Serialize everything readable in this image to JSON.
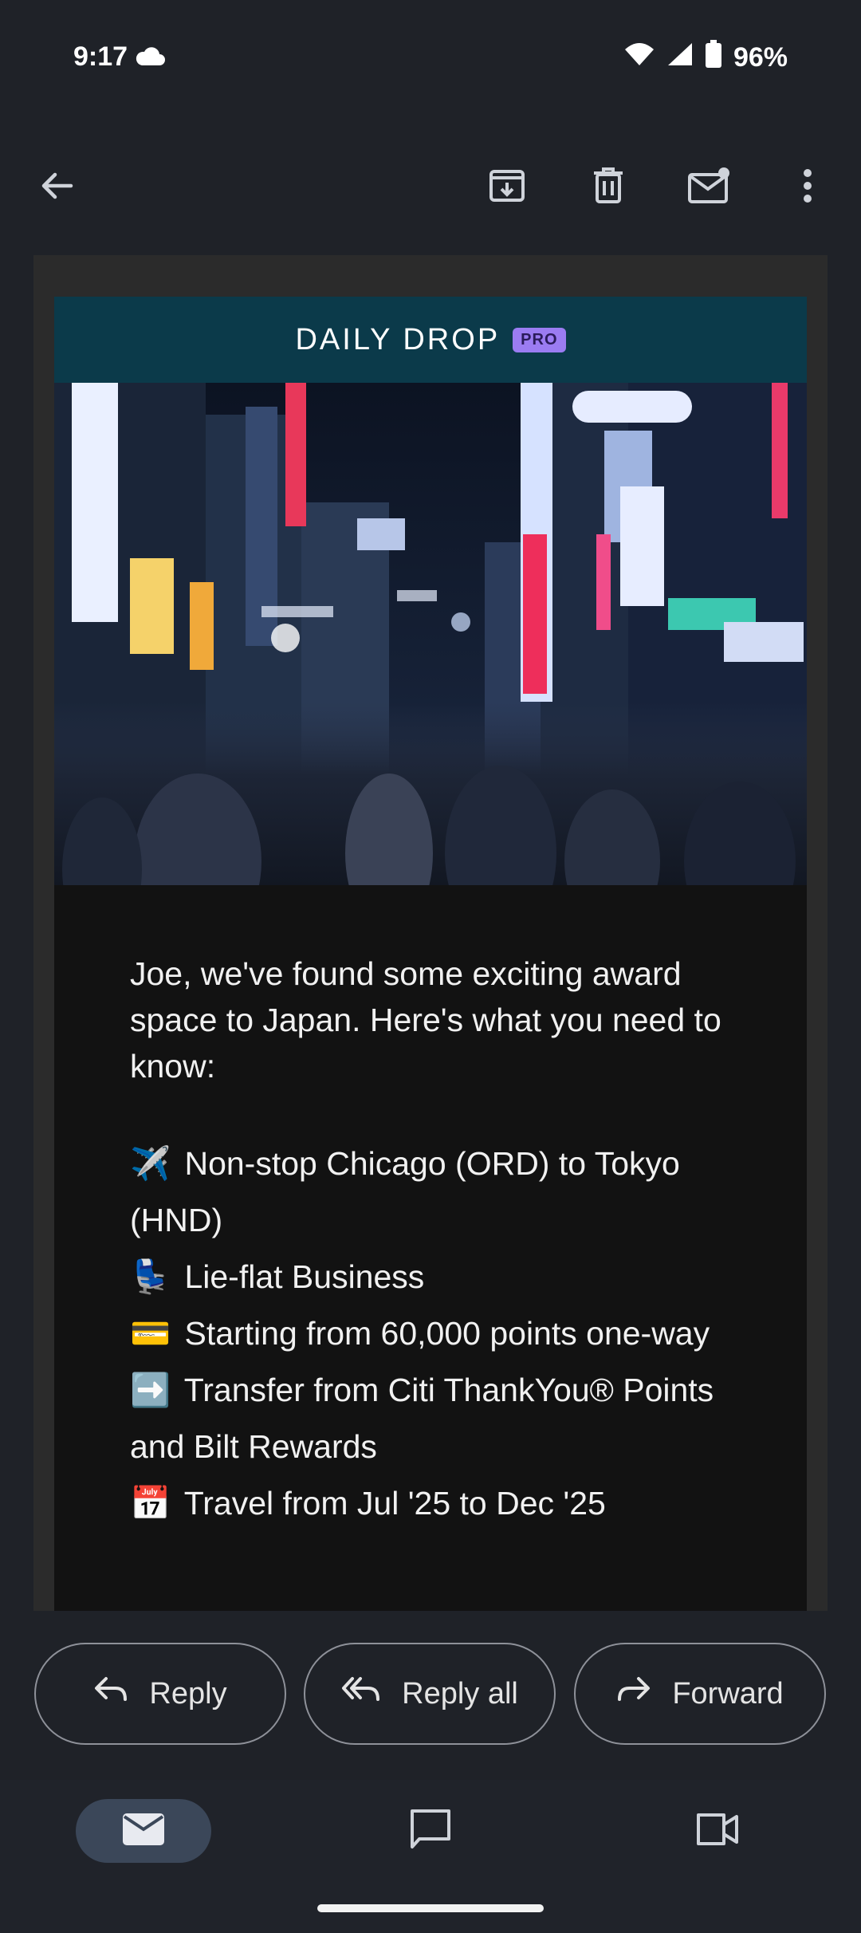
{
  "status_bar": {
    "time": "9:17",
    "battery": "96%"
  },
  "toolbar": {
    "back": "arrow-left-icon",
    "archive": "archive-icon",
    "delete": "trash-icon",
    "mark_unread": "mail-unread-icon",
    "more": "more-vert-icon"
  },
  "email": {
    "brand": {
      "name": "DAILY DR",
      "logo_char": "O",
      "name_end": "P",
      "badge": "PRO",
      "color": "#0b3a4a",
      "badge_color": "#9b7cf2"
    },
    "intro": "Joe, we've found some exciting award space to Japan. Here's what you need to know:",
    "bullets": [
      {
        "emoji": "✈️",
        "text": "Non-stop Chicago (ORD) to Tokyo (HND)"
      },
      {
        "emoji": "💺",
        "text": "Lie-flat Business"
      },
      {
        "emoji": "💳",
        "text": "Starting from 60,000 points one-way"
      },
      {
        "emoji": "➡️",
        "text": "Transfer from Citi ThankYou® Points and Bilt Rewards"
      },
      {
        "emoji": "📅",
        "text": "Travel from Jul '25 to Dec '25"
      }
    ]
  },
  "actions": {
    "reply": "Reply",
    "reply_all": "Reply all",
    "forward": "Forward"
  },
  "bottom_nav": {
    "mail": "mail-icon",
    "chat": "chat-icon",
    "meet": "video-icon"
  }
}
